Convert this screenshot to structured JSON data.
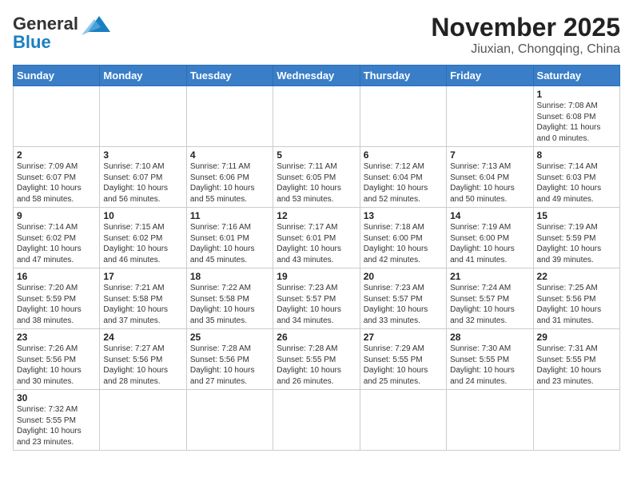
{
  "logo": {
    "line1": "General",
    "line2": "Blue"
  },
  "title": "November 2025",
  "subtitle": "Jiuxian, Chongqing, China",
  "weekdays": [
    "Sunday",
    "Monday",
    "Tuesday",
    "Wednesday",
    "Thursday",
    "Friday",
    "Saturday"
  ],
  "days": {
    "1": {
      "sunrise": "7:08 AM",
      "sunset": "6:08 PM",
      "daylight": "11 hours and 0 minutes."
    },
    "2": {
      "sunrise": "7:09 AM",
      "sunset": "6:07 PM",
      "daylight": "10 hours and 58 minutes."
    },
    "3": {
      "sunrise": "7:10 AM",
      "sunset": "6:07 PM",
      "daylight": "10 hours and 56 minutes."
    },
    "4": {
      "sunrise": "7:11 AM",
      "sunset": "6:06 PM",
      "daylight": "10 hours and 55 minutes."
    },
    "5": {
      "sunrise": "7:11 AM",
      "sunset": "6:05 PM",
      "daylight": "10 hours and 53 minutes."
    },
    "6": {
      "sunrise": "7:12 AM",
      "sunset": "6:04 PM",
      "daylight": "10 hours and 52 minutes."
    },
    "7": {
      "sunrise": "7:13 AM",
      "sunset": "6:04 PM",
      "daylight": "10 hours and 50 minutes."
    },
    "8": {
      "sunrise": "7:14 AM",
      "sunset": "6:03 PM",
      "daylight": "10 hours and 49 minutes."
    },
    "9": {
      "sunrise": "7:14 AM",
      "sunset": "6:02 PM",
      "daylight": "10 hours and 47 minutes."
    },
    "10": {
      "sunrise": "7:15 AM",
      "sunset": "6:02 PM",
      "daylight": "10 hours and 46 minutes."
    },
    "11": {
      "sunrise": "7:16 AM",
      "sunset": "6:01 PM",
      "daylight": "10 hours and 45 minutes."
    },
    "12": {
      "sunrise": "7:17 AM",
      "sunset": "6:01 PM",
      "daylight": "10 hours and 43 minutes."
    },
    "13": {
      "sunrise": "7:18 AM",
      "sunset": "6:00 PM",
      "daylight": "10 hours and 42 minutes."
    },
    "14": {
      "sunrise": "7:19 AM",
      "sunset": "6:00 PM",
      "daylight": "10 hours and 41 minutes."
    },
    "15": {
      "sunrise": "7:19 AM",
      "sunset": "5:59 PM",
      "daylight": "10 hours and 39 minutes."
    },
    "16": {
      "sunrise": "7:20 AM",
      "sunset": "5:59 PM",
      "daylight": "10 hours and 38 minutes."
    },
    "17": {
      "sunrise": "7:21 AM",
      "sunset": "5:58 PM",
      "daylight": "10 hours and 37 minutes."
    },
    "18": {
      "sunrise": "7:22 AM",
      "sunset": "5:58 PM",
      "daylight": "10 hours and 35 minutes."
    },
    "19": {
      "sunrise": "7:23 AM",
      "sunset": "5:57 PM",
      "daylight": "10 hours and 34 minutes."
    },
    "20": {
      "sunrise": "7:23 AM",
      "sunset": "5:57 PM",
      "daylight": "10 hours and 33 minutes."
    },
    "21": {
      "sunrise": "7:24 AM",
      "sunset": "5:57 PM",
      "daylight": "10 hours and 32 minutes."
    },
    "22": {
      "sunrise": "7:25 AM",
      "sunset": "5:56 PM",
      "daylight": "10 hours and 31 minutes."
    },
    "23": {
      "sunrise": "7:26 AM",
      "sunset": "5:56 PM",
      "daylight": "10 hours and 30 minutes."
    },
    "24": {
      "sunrise": "7:27 AM",
      "sunset": "5:56 PM",
      "daylight": "10 hours and 28 minutes."
    },
    "25": {
      "sunrise": "7:28 AM",
      "sunset": "5:56 PM",
      "daylight": "10 hours and 27 minutes."
    },
    "26": {
      "sunrise": "7:28 AM",
      "sunset": "5:55 PM",
      "daylight": "10 hours and 26 minutes."
    },
    "27": {
      "sunrise": "7:29 AM",
      "sunset": "5:55 PM",
      "daylight": "10 hours and 25 minutes."
    },
    "28": {
      "sunrise": "7:30 AM",
      "sunset": "5:55 PM",
      "daylight": "10 hours and 24 minutes."
    },
    "29": {
      "sunrise": "7:31 AM",
      "sunset": "5:55 PM",
      "daylight": "10 hours and 23 minutes."
    },
    "30": {
      "sunrise": "7:32 AM",
      "sunset": "5:55 PM",
      "daylight": "10 hours and 23 minutes."
    }
  },
  "labels": {
    "sunrise": "Sunrise:",
    "sunset": "Sunset:",
    "daylight": "Daylight:"
  }
}
